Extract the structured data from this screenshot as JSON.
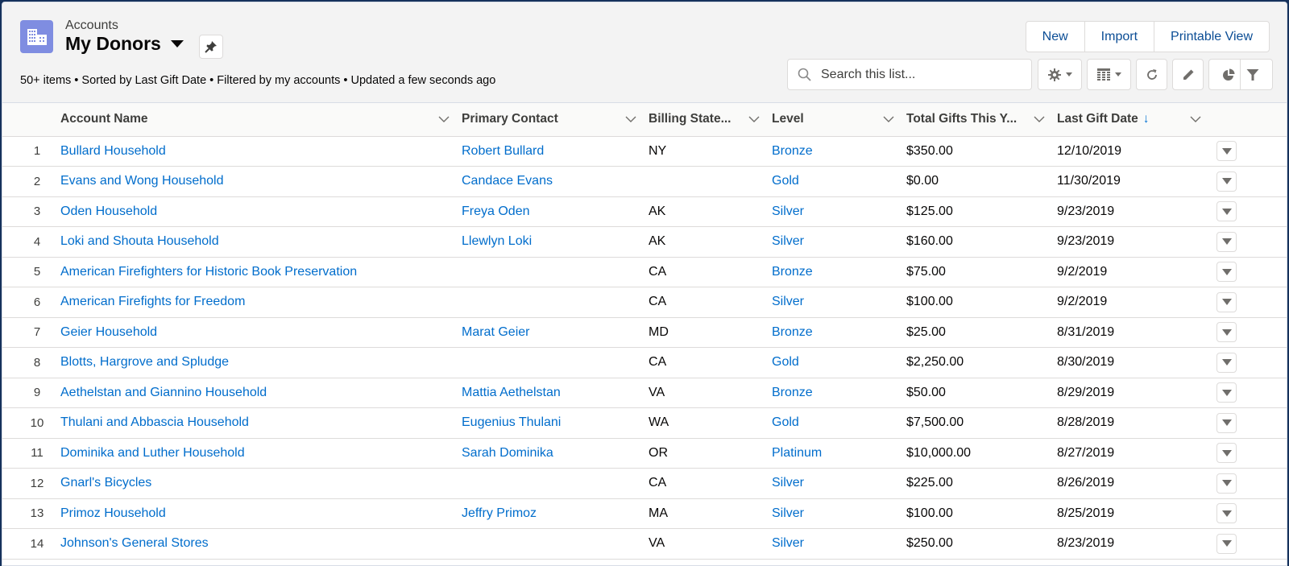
{
  "header": {
    "object_label": "Accounts",
    "list_title": "My Donors",
    "subtitle": "50+ items • Sorted by Last Gift Date • Filtered by my accounts • Updated a few seconds ago",
    "icons": {
      "object": "building-icon",
      "title_dropdown": "caret-down-icon",
      "pin": "pin-icon"
    }
  },
  "actions": {
    "buttons": [
      "New",
      "Import",
      "Printable View"
    ]
  },
  "toolbar": {
    "search_placeholder": "Search this list...",
    "search_value": "",
    "icons": [
      "settings-icon",
      "table-view-icon",
      "refresh-icon",
      "edit-icon",
      "chart-icon",
      "filter-icon"
    ]
  },
  "table": {
    "columns": [
      {
        "label": "Account Name"
      },
      {
        "label": "Primary Contact"
      },
      {
        "label": "Billing State..."
      },
      {
        "label": "Level"
      },
      {
        "label": "Total Gifts This Y..."
      },
      {
        "label": "Last Gift Date",
        "sort": "↓"
      }
    ],
    "rows": [
      {
        "num": "1",
        "account": "Bullard Household",
        "contact": "Robert Bullard",
        "state": "NY",
        "level": "Bronze",
        "total": "$350.00",
        "date": "12/10/2019"
      },
      {
        "num": "2",
        "account": "Evans and Wong Household",
        "contact": "Candace Evans",
        "state": "",
        "level": "Gold",
        "total": "$0.00",
        "date": "11/30/2019"
      },
      {
        "num": "3",
        "account": "Oden Household",
        "contact": "Freya Oden",
        "state": "AK",
        "level": "Silver",
        "total": "$125.00",
        "date": "9/23/2019"
      },
      {
        "num": "4",
        "account": "Loki and Shouta Household",
        "contact": "Llewlyn Loki",
        "state": "AK",
        "level": "Silver",
        "total": "$160.00",
        "date": "9/23/2019"
      },
      {
        "num": "5",
        "account": "American Firefighters for Historic Book Preservation",
        "contact": "",
        "state": "CA",
        "level": "Bronze",
        "total": "$75.00",
        "date": "9/2/2019"
      },
      {
        "num": "6",
        "account": "American Firefights for Freedom",
        "contact": "",
        "state": "CA",
        "level": "Silver",
        "total": "$100.00",
        "date": "9/2/2019"
      },
      {
        "num": "7",
        "account": "Geier Household",
        "contact": "Marat Geier",
        "state": "MD",
        "level": "Bronze",
        "total": "$25.00",
        "date": "8/31/2019"
      },
      {
        "num": "8",
        "account": "Blotts, Hargrove and Spludge",
        "contact": "",
        "state": "CA",
        "level": "Gold",
        "total": "$2,250.00",
        "date": "8/30/2019"
      },
      {
        "num": "9",
        "account": "Aethelstan and Giannino Household",
        "contact": "Mattia Aethelstan",
        "state": "VA",
        "level": "Bronze",
        "total": "$50.00",
        "date": "8/29/2019"
      },
      {
        "num": "10",
        "account": "Thulani and Abbascia Household",
        "contact": "Eugenius Thulani",
        "state": "WA",
        "level": "Gold",
        "total": "$7,500.00",
        "date": "8/28/2019"
      },
      {
        "num": "11",
        "account": "Dominika and Luther Household",
        "contact": "Sarah Dominika",
        "state": "OR",
        "level": "Platinum",
        "total": "$10,000.00",
        "date": "8/27/2019"
      },
      {
        "num": "12",
        "account": "Gnarl's Bicycles",
        "contact": "",
        "state": "CA",
        "level": "Silver",
        "total": "$225.00",
        "date": "8/26/2019"
      },
      {
        "num": "13",
        "account": "Primoz Household",
        "contact": "Jeffry Primoz",
        "state": "MA",
        "level": "Silver",
        "total": "$100.00",
        "date": "8/25/2019"
      },
      {
        "num": "14",
        "account": "Johnson's General Stores",
        "contact": "",
        "state": "VA",
        "level": "Silver",
        "total": "$250.00",
        "date": "8/23/2019"
      }
    ]
  },
  "colors": {
    "link": "#006dcc",
    "button_text": "#0b4d95",
    "object_icon_bg": "#7f8de1",
    "sort_arrow": "#0070d2"
  }
}
